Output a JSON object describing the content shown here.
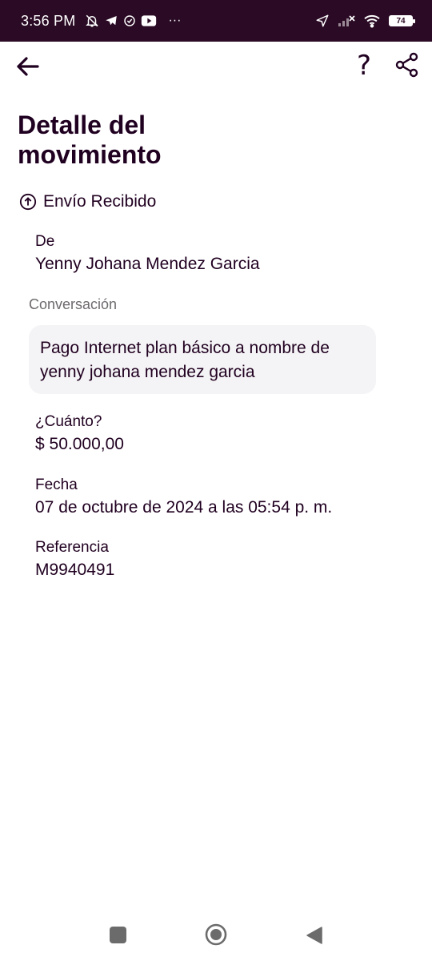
{
  "status_bar": {
    "time": "3:56 PM",
    "battery": "74",
    "more": "···"
  },
  "header": {
    "help": "?"
  },
  "page": {
    "title_line1": "Detalle del",
    "title_line2": "movimiento",
    "type_label": "Envío Recibido"
  },
  "from": {
    "label": "De",
    "value": "Yenny Johana Mendez Garcia"
  },
  "conversation": {
    "label": "Conversación",
    "message_line1": "Pago Internet plan básico a nombre de",
    "message_line2": "yenny johana mendez garcia"
  },
  "amount": {
    "label": "¿Cuánto?",
    "value": "$ 50.000,00"
  },
  "date": {
    "label": "Fecha",
    "value": "07 de octubre de 2024 a las 05:54 p. m."
  },
  "reference": {
    "label": "Referencia",
    "value": "M9940491"
  },
  "colors": {
    "status_bar_bg": "#2a0a24",
    "text_primary": "#200020",
    "bubble_bg": "#f4f3f5"
  }
}
